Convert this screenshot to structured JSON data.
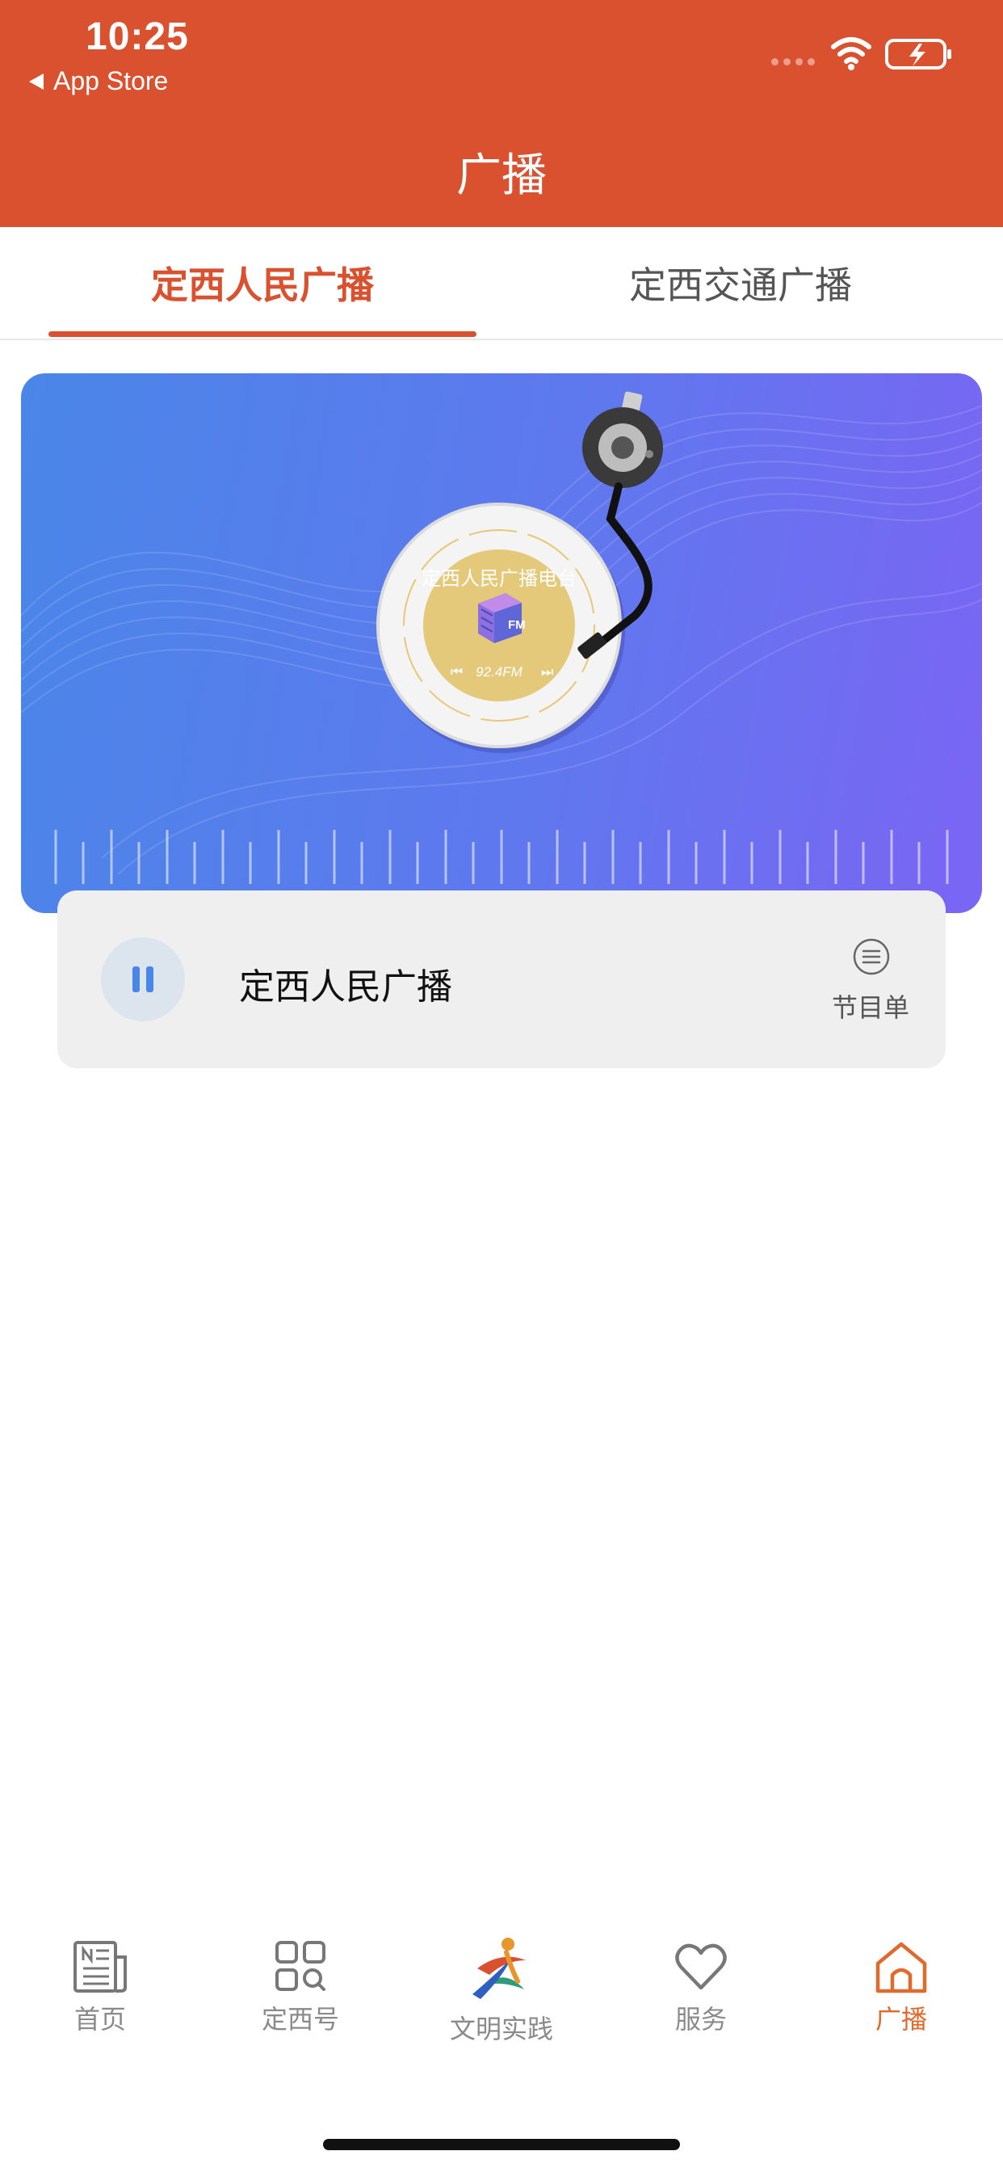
{
  "status_bar": {
    "time": "10:25",
    "back_label": "App Store"
  },
  "header": {
    "title": "广播"
  },
  "tabs": [
    {
      "label": "定西人民广播",
      "active": true
    },
    {
      "label": "定西交通广播",
      "active": false
    }
  ],
  "banner": {
    "record_title": "定西人民广播电台",
    "frequency": "92.4FM",
    "badge": "FM"
  },
  "player": {
    "station_name": "定西人民广播",
    "state": "playing",
    "playlist_label": "节目单"
  },
  "bottom_nav": [
    {
      "label": "首页",
      "icon": "news-icon",
      "active": false
    },
    {
      "label": "定西号",
      "icon": "grid-search-icon",
      "active": false
    },
    {
      "label": "文明实践",
      "icon": "civilization-logo-icon",
      "active": false
    },
    {
      "label": "服务",
      "icon": "heart-icon",
      "active": false
    },
    {
      "label": "广播",
      "icon": "home-icon",
      "active": true
    }
  ],
  "colors": {
    "accent": "#d9512f",
    "inactive": "#8a8a8a",
    "play_accent": "#4a86e8"
  }
}
